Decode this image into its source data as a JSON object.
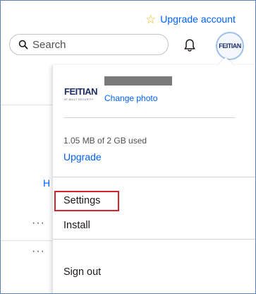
{
  "header": {
    "upgrade_account": "Upgrade account",
    "star_icon": "star-outline-icon",
    "search_placeholder": "Search",
    "search_icon": "search-icon",
    "bell_icon": "bell-icon",
    "avatar_logo": "FEITIAN"
  },
  "menu": {
    "logo_text": "FEITIAN",
    "logo_tagline": "AT BUILT SECURITY",
    "change_photo": "Change photo",
    "storage": "1.05 MB of 2 GB used",
    "upgrade": "Upgrade",
    "settings": "Settings",
    "install": "Install",
    "sign_out": "Sign out"
  },
  "background": {
    "partial_link": "H",
    "row_menu_1": "···",
    "row_menu_2": "···"
  },
  "colors": {
    "link_blue": "#0061fe",
    "star_yellow": "#f2b01e",
    "highlight_red": "#d12631",
    "frame_border": "#5f7fb8"
  }
}
